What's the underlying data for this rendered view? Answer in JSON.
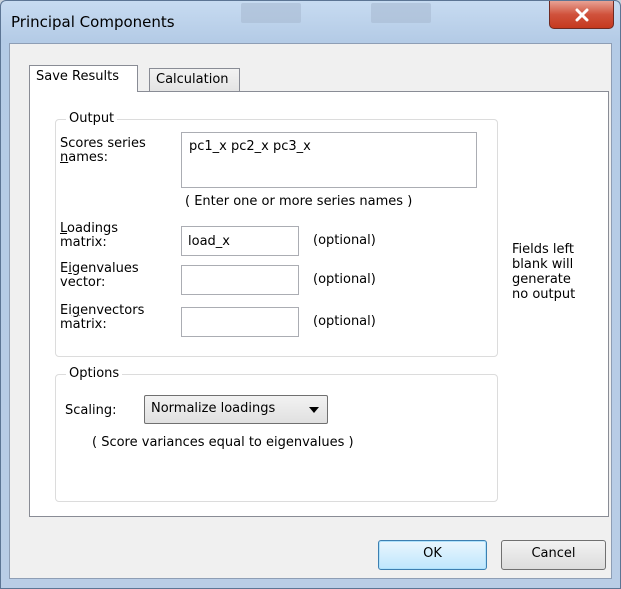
{
  "window": {
    "title": "Principal Components"
  },
  "tabs": [
    {
      "label": "Save Results",
      "active": true
    },
    {
      "label": "Calculation",
      "active": false
    }
  ],
  "output": {
    "group_label": "Output",
    "scores_label_line1": "Scores series",
    "scores_label_line2_mnemonic": "n",
    "scores_label_line2_rest": "ames:",
    "scores_value": "pc1_x pc2_x pc3_x",
    "scores_hint": "( Enter one or more series names )",
    "loadings_label_mnemonic": "L",
    "loadings_label_rest": "oadings",
    "loadings_label_line2": "matrix:",
    "loadings_value": "load_x",
    "eigenvalues_label_pre": "E",
    "eigenvalues_label_mnemonic": "i",
    "eigenvalues_label_rest": "genvalues",
    "eigenvalues_label_line2": "vector:",
    "eigenvalues_value": "",
    "eigenvectors_label_pre": "Ei",
    "eigenvectors_label_mnemonic": "g",
    "eigenvectors_label_rest": "envectors",
    "eigenvectors_label_line2": "matrix:",
    "eigenvectors_value": "",
    "optional_text": "(optional)",
    "side_note": [
      "Fields left",
      "blank will",
      "generate",
      "no output"
    ]
  },
  "options": {
    "group_label": "Options",
    "scaling_label": "Scaling:",
    "scaling_selected": "Normalize loadings",
    "scaling_note": "( Score variances equal to eigenvalues )"
  },
  "buttons": {
    "ok": "OK",
    "cancel": "Cancel"
  }
}
